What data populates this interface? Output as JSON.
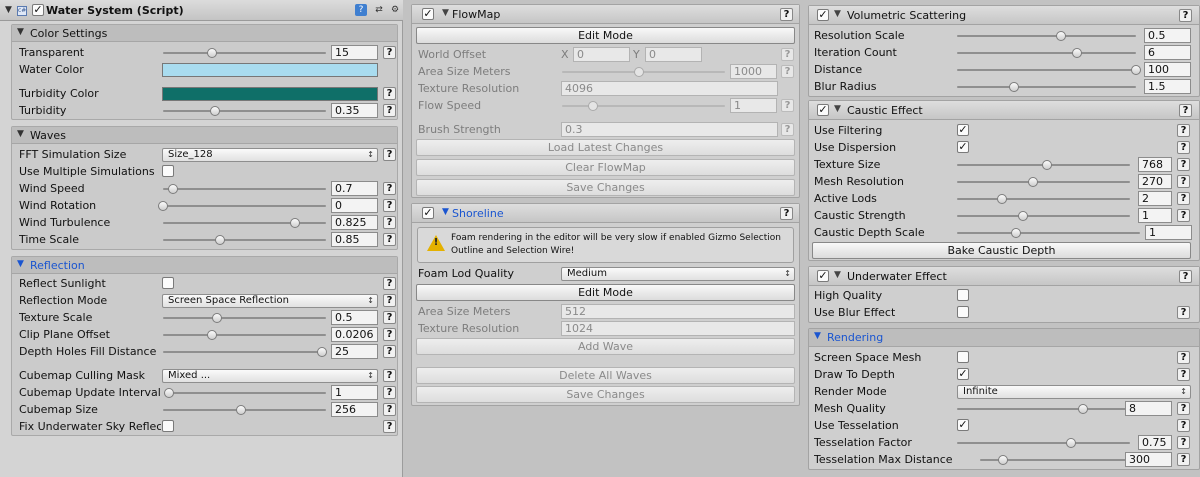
{
  "water": {
    "title": "Water System (Script)",
    "header_icon": "cs-script-icon",
    "header_buttons": {
      "help": "?",
      "presets": "⇄",
      "settings": "⚙"
    },
    "color_settings": {
      "title": "Color Settings",
      "transparent": {
        "label": "Transparent",
        "value": "15",
        "fraction": 0.3
      },
      "water_color": {
        "label": "Water Color",
        "color": "#a9dcef"
      },
      "turbidity_color": {
        "label": "Turbidity Color",
        "color": "#0f6f68"
      },
      "turbidity": {
        "label": "Turbidity",
        "value": "0.35",
        "fraction": 0.32
      }
    },
    "waves": {
      "title": "Waves",
      "fft": {
        "label": "FFT Simulation Size",
        "value": "Size_128"
      },
      "multiple": {
        "label": "Use Multiple Simulations"
      },
      "wind_speed": {
        "label": "Wind Speed",
        "value": "0.7",
        "fraction": 0.06
      },
      "wind_rotation": {
        "label": "Wind Rotation",
        "value": "0",
        "fraction": 0.0
      },
      "wind_turbulence": {
        "label": "Wind Turbulence",
        "value": "0.825",
        "fraction": 0.81
      },
      "time_scale": {
        "label": "Time Scale",
        "value": "0.85",
        "fraction": 0.35
      }
    },
    "reflection": {
      "title": "Reflection",
      "reflect_sunlight": {
        "label": "Reflect Sunlight"
      },
      "mode": {
        "label": "Reflection Mode",
        "value": "Screen Space Reflection"
      },
      "texture_scale": {
        "label": "Texture Scale",
        "value": "0.5",
        "fraction": 0.33
      },
      "clip_plane_offset": {
        "label": "Clip Plane Offset",
        "value": "0.0206",
        "fraction": 0.3
      },
      "depth_holes": {
        "label": "Depth Holes Fill Distance",
        "value": "25",
        "fraction": 1.0
      },
      "culling_mask": {
        "label": "Cubemap Culling Mask",
        "value": "Mixed ..."
      },
      "update_interval": {
        "label": "Cubemap Update Interval",
        "value": "1",
        "fraction": 0.0
      },
      "cubemap_size": {
        "label": "Cubemap Size",
        "value": "256",
        "fraction": 0.48
      },
      "fix_underwater": {
        "label": "Fix Underwater Sky Reflection"
      }
    }
  },
  "flowmap": {
    "title": "FlowMap",
    "edit_mode": "Edit Mode",
    "world_offset": {
      "label": "World Offset",
      "x_label": "X",
      "x": "0",
      "y_label": "Y",
      "y": "0"
    },
    "area_size": {
      "label": "Area Size Meters",
      "value": "1000",
      "fraction": 0.47
    },
    "texture_resolution": {
      "label": "Texture Resolution",
      "value": "4096"
    },
    "flow_speed": {
      "label": "Flow Speed",
      "value": "1",
      "fraction": 0.19
    },
    "brush_strength": {
      "label": "Brush Strength",
      "value": "0.3"
    },
    "load_changes": "Load Latest Changes",
    "clear": "Clear FlowMap",
    "save": "Save Changes"
  },
  "shoreline": {
    "title": "Shoreline",
    "warning": "Foam rendering in the editor will be very slow if enabled Gizmo Selection Outline and Selection Wire!",
    "foam_lod": {
      "label": "Foam Lod Quality",
      "value": "Medium"
    },
    "edit_mode": "Edit Mode",
    "area_size": {
      "label": "Area Size Meters",
      "value": "512"
    },
    "texture_resolution": {
      "label": "Texture Resolution",
      "value": "1024"
    },
    "add_wave": "Add Wave",
    "delete_waves": "Delete All Waves",
    "save": "Save Changes"
  },
  "volumetric": {
    "title": "Volumetric Scattering",
    "resolution_scale": {
      "label": "Resolution Scale",
      "value": "0.5",
      "fraction": 0.58
    },
    "iteration_count": {
      "label": "Iteration Count",
      "value": "6",
      "fraction": 0.67
    },
    "distance": {
      "label": "Distance",
      "value": "100",
      "fraction": 1.0
    },
    "blur_radius": {
      "label": "Blur Radius",
      "value": "1.5",
      "fraction": 0.32
    }
  },
  "caustic": {
    "title": "Caustic Effect",
    "use_filtering": {
      "label": "Use Filtering"
    },
    "use_dispersion": {
      "label": "Use Dispersion"
    },
    "texture_size": {
      "label": "Texture Size",
      "value": "768",
      "fraction": 0.52
    },
    "mesh_resolution": {
      "label": "Mesh Resolution",
      "value": "270",
      "fraction": 0.44
    },
    "active_lods": {
      "label": "Active Lods",
      "value": "2",
      "fraction": 0.26
    },
    "caustic_strength": {
      "label": "Caustic Strength",
      "value": "1",
      "fraction": 0.38
    },
    "caustic_depth_scale": {
      "label": "Caustic Depth Scale",
      "value": "1",
      "fraction": 0.32
    },
    "bake": "Bake Caustic Depth"
  },
  "underwater": {
    "title": "Underwater Effect",
    "high_quality": {
      "label": "High Quality"
    },
    "use_blur": {
      "label": "Use Blur Effect"
    }
  },
  "rendering": {
    "title": "Rendering",
    "screen_space_mesh": {
      "label": "Screen Space Mesh"
    },
    "draw_to_depth": {
      "label": "Draw To Depth"
    },
    "render_mode": {
      "label": "Render Mode",
      "value": "Infinite"
    },
    "mesh_quality": {
      "label": "Mesh Quality",
      "value": "8",
      "fraction": 0.73
    },
    "use_tesselation": {
      "label": "Use Tesselation"
    },
    "tesselation_factor": {
      "label": "Tesselation Factor",
      "value": "0.75",
      "fraction": 0.66
    },
    "tesselation_max_distance": {
      "label": "Tesselation Max Distance",
      "value": "300",
      "fraction": 0.15
    }
  },
  "glyphs": {
    "check": "✓",
    "help": "?",
    "tri_down": "▼",
    "dd_arrow": "↕",
    "warn": "!"
  }
}
